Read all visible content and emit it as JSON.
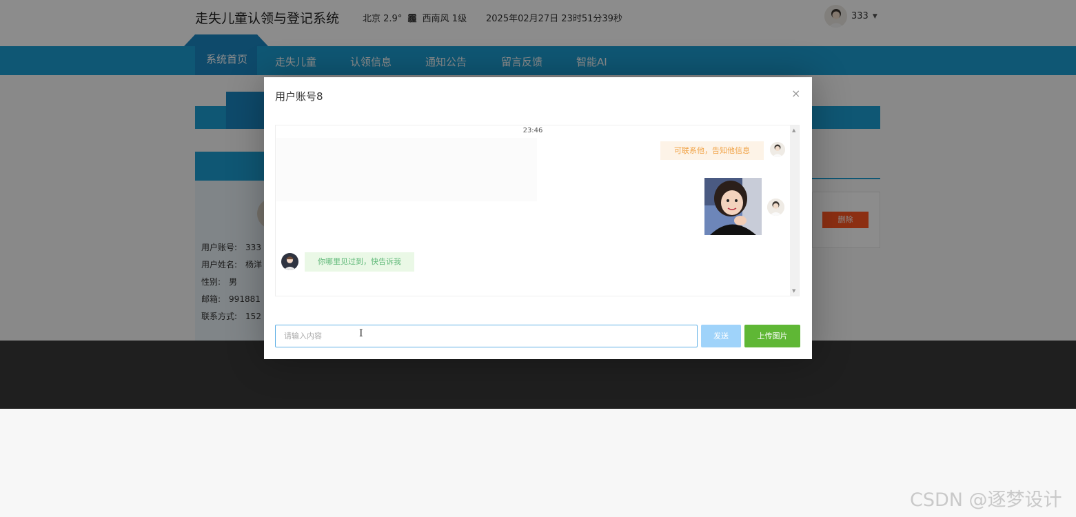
{
  "header": {
    "site_title": "走失儿童认领与登记系统",
    "weather": {
      "city": "北京",
      "temp": "2.9°",
      "icon_text": "霾",
      "wind": "西南风",
      "level": "1级"
    },
    "datetime": "2025年02月27日 23时51分39秒",
    "user_name": "333",
    "user_avatar_icon": "user-avatar-icon"
  },
  "nav": {
    "items": [
      "系统首页",
      "走失儿童",
      "认领信息",
      "通知公告",
      "留言反馈",
      "智能AI"
    ],
    "active_index": 0
  },
  "profile": {
    "rows": [
      {
        "label": "用户账号:",
        "value": "333"
      },
      {
        "label": "用户姓名:",
        "value": "杨洋"
      },
      {
        "label": "性别:",
        "value": "男"
      },
      {
        "label": "邮箱:",
        "value": "991881"
      },
      {
        "label": "联系方式:",
        "value": "152"
      }
    ],
    "delete_label": "删除"
  },
  "dialog": {
    "title": "用户账号8",
    "close_icon": "close-icon",
    "time": "23:46",
    "messages": [
      {
        "side": "right",
        "type": "text",
        "text": "可联系他，告知他信息"
      },
      {
        "side": "right",
        "type": "image",
        "icon": "child-photo-image"
      },
      {
        "side": "left",
        "type": "text",
        "text": "你哪里见过到，快告诉我"
      }
    ],
    "input_placeholder": "请输入内容",
    "send_label": "发送",
    "upload_label": "上传图片"
  },
  "watermark": "CSDN @逐梦设计",
  "colors": {
    "nav_blue": "#1c9fd4",
    "send_blue": "#9fd3fa",
    "upload_green": "#5fb735",
    "delete_orange": "#ff5722"
  }
}
